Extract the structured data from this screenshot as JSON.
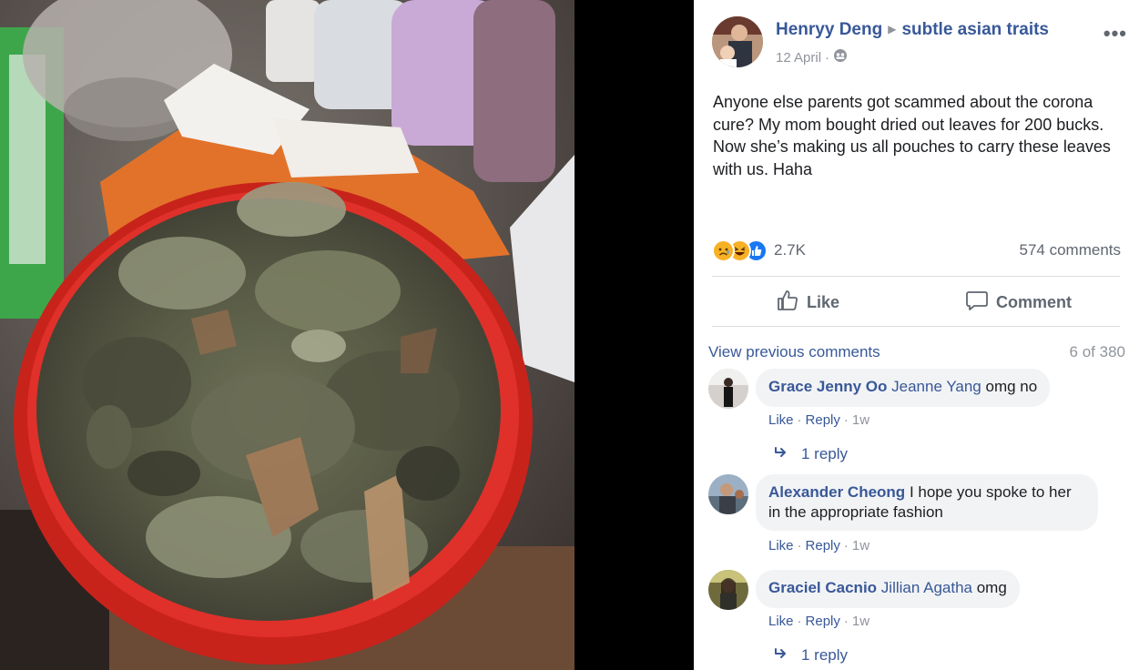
{
  "post": {
    "author": "Henryy Deng",
    "group": "subtle asian traits",
    "date": "12 April",
    "date_sep": "·",
    "more": "•••",
    "text": "Anyone else parents got scammed about the corona cure? My mom bought dried out leaves for 200 bucks. Now she’s making us all pouches to carry these leaves with us. Haha",
    "reaction_count": "2.7K",
    "comment_count": "574 comments",
    "reactions": [
      "sad-reaction-icon",
      "haha-reaction-icon",
      "like-reaction-icon"
    ]
  },
  "actions": {
    "like": "Like",
    "comment": "Comment"
  },
  "comments_section": {
    "view_previous": "View previous comments",
    "count": "6 of 380",
    "comments": [
      {
        "name": "Grace Jenny Oo",
        "tag": "Jeanne Yang",
        "text": "omg no",
        "like": "Like",
        "reply": "Reply",
        "sep": "·",
        "time": "1w",
        "replies": "1 reply"
      },
      {
        "name": "Alexander Cheong",
        "tag": "",
        "text": "I hope you spoke to her in the appropriate fashion",
        "like": "Like",
        "reply": "Reply",
        "sep": "·",
        "time": "1w",
        "replies": ""
      },
      {
        "name": "Graciel Cacnio",
        "tag": "Jillian Agatha",
        "text": "omg",
        "like": "Like",
        "reply": "Reply",
        "sep": "·",
        "time": "1w",
        "replies": "1 reply"
      }
    ]
  },
  "colors": {
    "link": "#385898",
    "muted": "#90949c",
    "bubble": "#f2f3f5",
    "like_blue": "#1877f2",
    "reaction_yellow": "#f7b125",
    "bowl_red": "#d8261c"
  }
}
